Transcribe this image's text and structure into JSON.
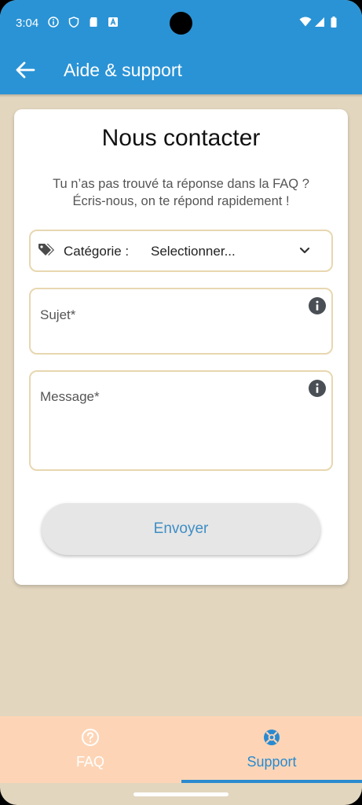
{
  "status_bar": {
    "time": "3:04"
  },
  "app_bar": {
    "title": "Aide & support"
  },
  "card": {
    "title": "Nous contacter",
    "subtitle_line1": "Tu n’as pas trouvé ta réponse dans la FAQ ?",
    "subtitle_line2": "Écris-nous, on te répond rapidement !"
  },
  "form": {
    "category_label": "Catégorie :",
    "category_value": "Selectionner...",
    "subject_placeholder": "Sujet*",
    "message_placeholder": "Message*",
    "send_label": "Envoyer"
  },
  "bottom_nav": {
    "items": [
      {
        "label": "FAQ",
        "icon": "help-circle-icon",
        "active": false
      },
      {
        "label": "Support",
        "icon": "lifebuoy-icon",
        "active": true
      }
    ]
  },
  "colors": {
    "primary": "#2a93d5",
    "background": "#e2d6bf",
    "field_border": "#e8d7b0",
    "nav_background": "#fdd5b6",
    "active_nav": "#2a8ad0"
  }
}
